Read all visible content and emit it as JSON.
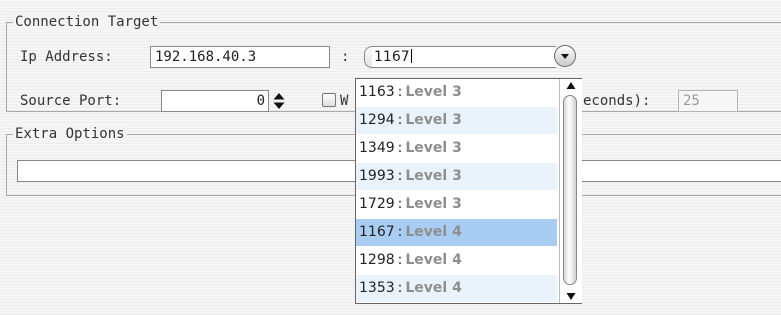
{
  "connection_target": {
    "title": "Connection Target",
    "ip_label": "Ip Address:",
    "ip_value": "192.168.40.3",
    "colon": ":",
    "port_value": "1167",
    "source_port_label": "Source Port:",
    "source_port_value": "0",
    "checkbox_fragment": "W",
    "timeout_label_fragment": "econds):",
    "timeout_value": "25"
  },
  "extra_options": {
    "title": "Extra Options",
    "value": ""
  },
  "port_dropdown": {
    "items": [
      {
        "port": "1163",
        "sep": ":",
        "level": "Level 3"
      },
      {
        "port": "1294",
        "sep": ":",
        "level": "Level 3"
      },
      {
        "port": "1349",
        "sep": ":",
        "level": "Level 3"
      },
      {
        "port": "1993",
        "sep": ":",
        "level": "Level 3"
      },
      {
        "port": "1729",
        "sep": ":",
        "level": "Level 3"
      },
      {
        "port": "1167",
        "sep": ":",
        "level": "Level 4"
      },
      {
        "port": "1298",
        "sep": ":",
        "level": "Level 4"
      },
      {
        "port": "1353",
        "sep": ":",
        "level": "Level 4"
      }
    ],
    "selected_index": 5
  },
  "icons": {
    "combo_button": "chevron-down-icon",
    "spinner": "up-down-arrows-icon",
    "scroll_up": "scroll-up-arrow-icon",
    "scroll_down": "scroll-down-arrow-icon"
  },
  "colors": {
    "selection": "#a9cdf2",
    "alternate_row": "#eaf2fb",
    "level_text": "#8e8e8e"
  }
}
